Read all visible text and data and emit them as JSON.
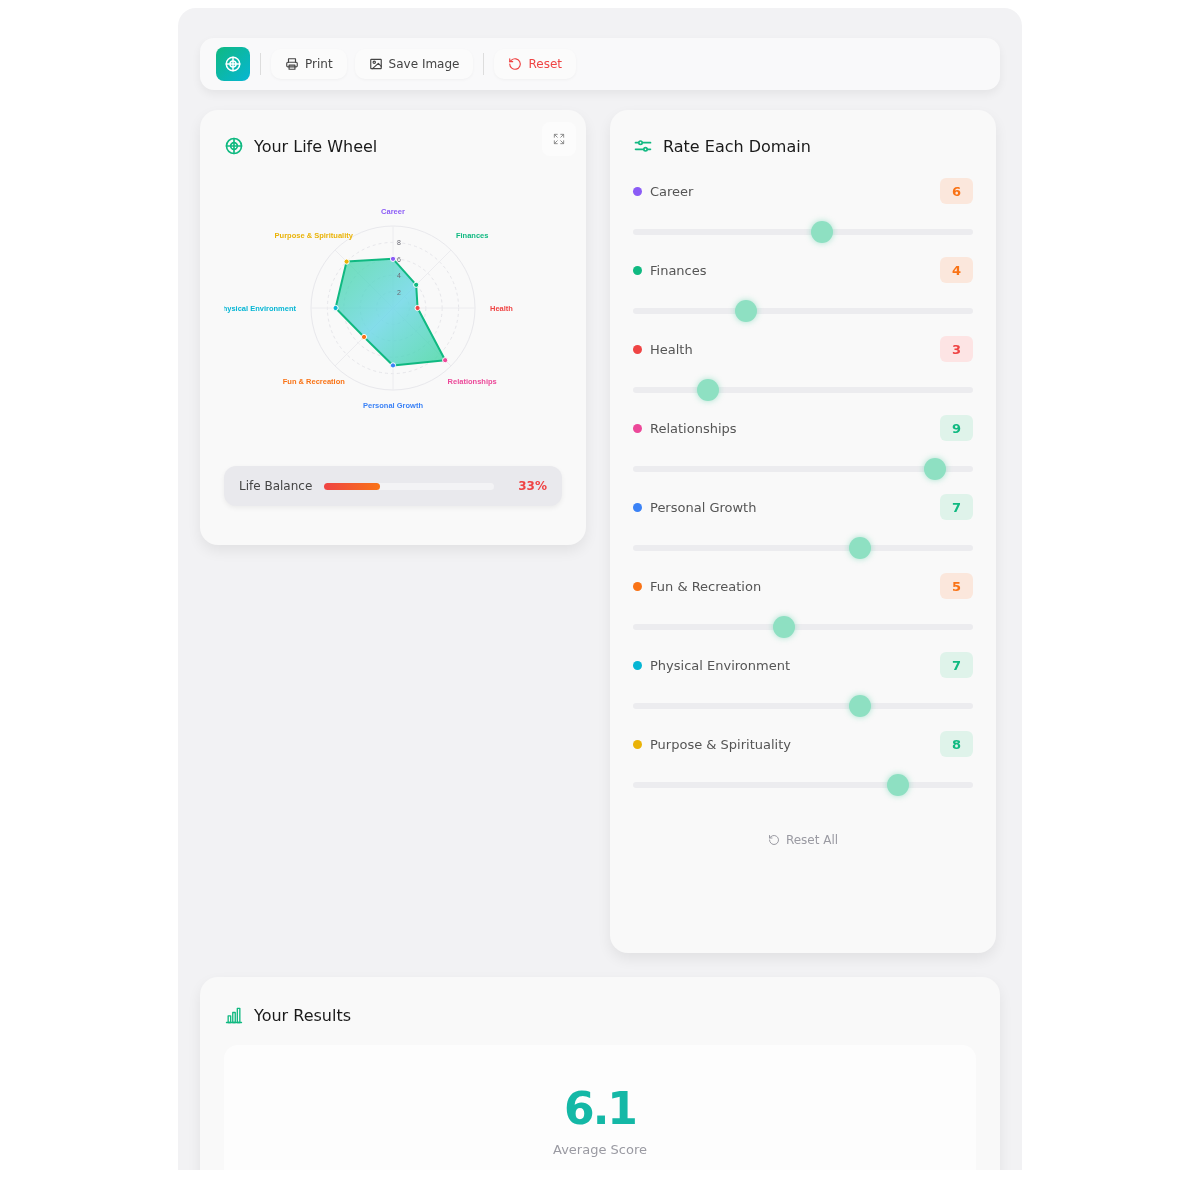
{
  "toolbar": {
    "buttons": [
      {
        "label": "Print",
        "kind": "print"
      },
      {
        "label": "Save Image",
        "kind": "image"
      },
      {
        "label": "Reset",
        "kind": "reset"
      }
    ]
  },
  "wheel": {
    "title": "Your Life Wheel",
    "radar": {
      "axis_labels": [
        "Career",
        "Finances",
        "Health",
        "Relationships",
        "Personal Growth",
        "Fun & Recreation",
        "hysical Environment",
        "Purpose & Spirituality"
      ],
      "tick_labels": [
        "8",
        "6",
        "4",
        "2"
      ]
    },
    "balance": {
      "label": "Life Balance",
      "level": 0.33,
      "reading": "33%"
    }
  },
  "domains": {
    "title": "Rate Each Domain",
    "items": [
      {
        "name": "Career",
        "color": "#8b5cf6",
        "value": "6",
        "level": 0.555
      },
      {
        "name": "Finances",
        "color": "#10b981",
        "value": "4",
        "level": 0.333
      },
      {
        "name": "Health",
        "color": "#ef4444",
        "value": "3",
        "level": 0.222
      },
      {
        "name": "Relationships",
        "color": "#ec4899",
        "value": "9",
        "level": 0.889
      },
      {
        "name": "Personal Growth",
        "color": "#3b82f6",
        "value": "7",
        "level": 0.667
      },
      {
        "name": "Fun & Recreation",
        "color": "#f97316",
        "value": "5",
        "level": 0.444
      },
      {
        "name": "Physical Environment",
        "color": "#06b6d4",
        "value": "7",
        "level": 0.667
      },
      {
        "name": "Purpose & Spirituality",
        "color": "#eab308",
        "value": "8",
        "level": 0.778
      }
    ],
    "reset": "Reset All"
  },
  "results": {
    "title": "Your Results",
    "score": "6.1",
    "caption": "Average Score"
  }
}
